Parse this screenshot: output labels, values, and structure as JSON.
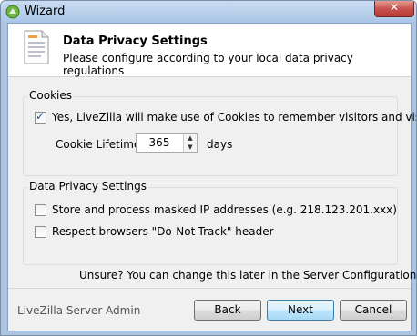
{
  "window": {
    "title": "Wizard"
  },
  "header": {
    "title": "Data Privacy Settings",
    "subtitle": "Please configure according to your local data privacy regulations"
  },
  "cookies": {
    "group_label": "Cookies",
    "use_cookies_label": "Yes, LiveZilla will make use of Cookies to remember visitors and visitor details.",
    "use_cookies_checked": true,
    "lifetime_label": "Cookie Lifetime:",
    "lifetime_value": "365",
    "lifetime_unit": "days"
  },
  "privacy": {
    "group_label": "Data Privacy Settings",
    "masked_ip_label": "Store and process masked IP addresses (e.g. 218.123.201.xxx)",
    "masked_ip_checked": false,
    "dnt_label": "Respect browsers \"Do-Not-Track\" header",
    "dnt_checked": false
  },
  "hint": "Unsure? You can change this later in the Server Configuration panel.",
  "footer": {
    "app_label": "LiveZilla Server Admin",
    "back_label": "Back",
    "next_label": "Next",
    "cancel_label": "Cancel"
  },
  "colors": {
    "titlebar": "#aac4e2",
    "close": "#c75050",
    "check": "#1c4fa0",
    "next_button": "#bee6fd"
  }
}
